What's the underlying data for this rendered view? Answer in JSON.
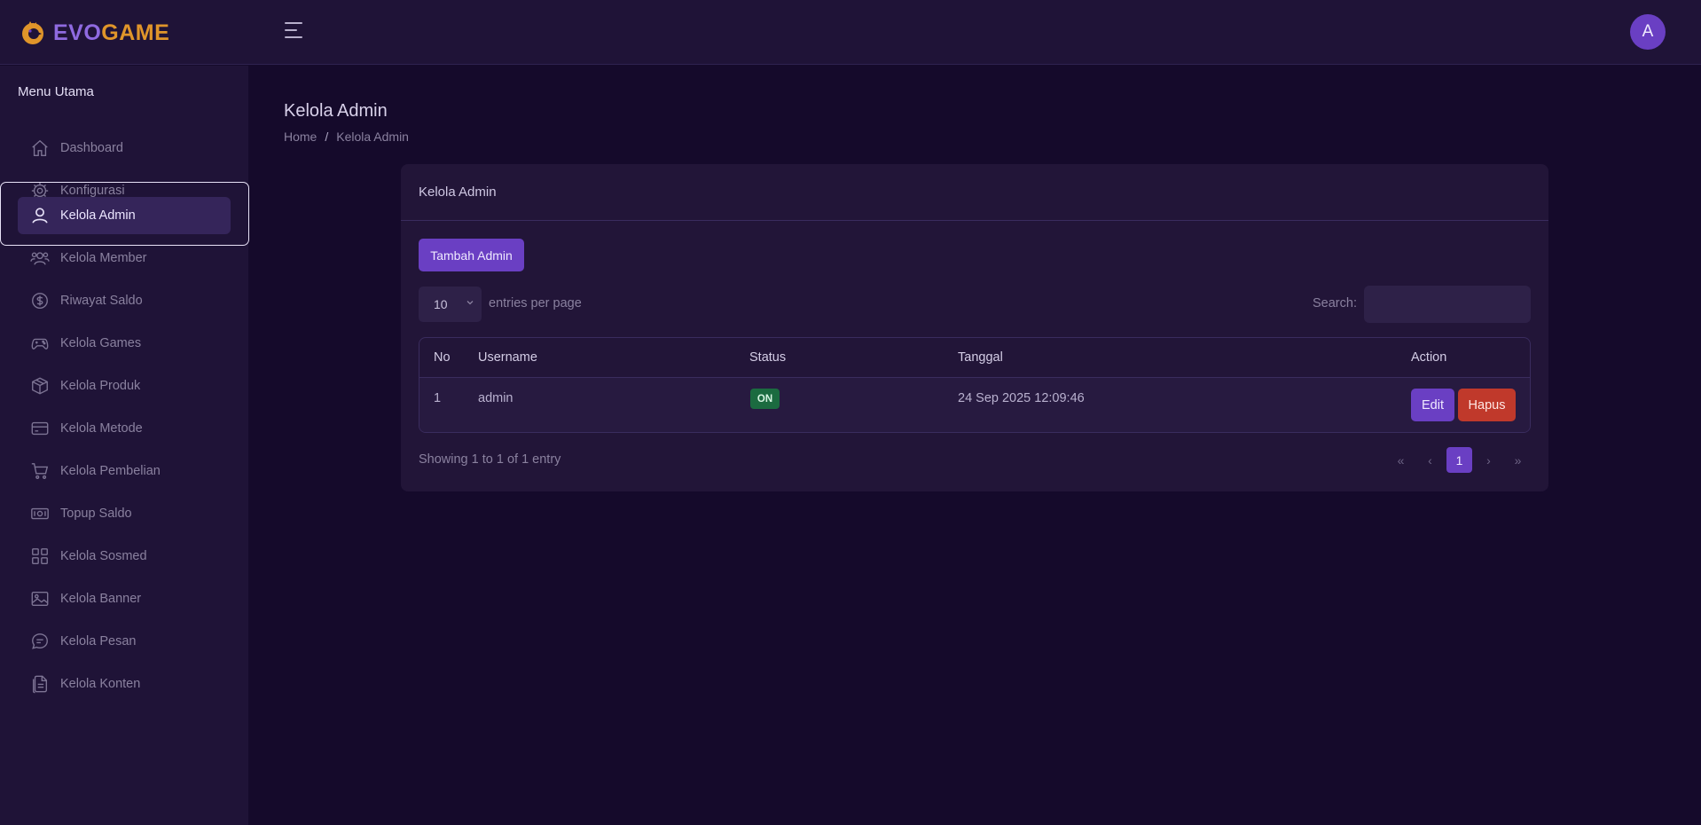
{
  "header": {
    "logo_part1": "EVO",
    "logo_part2": "GAME",
    "menu_toggle_icon": "hamburger-icon",
    "avatar_initial": "A"
  },
  "sidebar": {
    "title": "Menu Utama",
    "items": [
      {
        "label": "Dashboard",
        "icon": "home-icon"
      },
      {
        "label": "Konfigurasi",
        "icon": "gear-icon"
      },
      {
        "label": "Kelola Admin",
        "icon": "user-icon",
        "active": true
      },
      {
        "label": "Kelola Member",
        "icon": "users-icon"
      },
      {
        "label": "Riwayat Saldo",
        "icon": "dollar-icon"
      },
      {
        "label": "Kelola Games",
        "icon": "gamepad-icon"
      },
      {
        "label": "Kelola Produk",
        "icon": "box-icon"
      },
      {
        "label": "Kelola Metode",
        "icon": "card-icon"
      },
      {
        "label": "Kelola Pembelian",
        "icon": "cart-icon"
      },
      {
        "label": "Topup Saldo",
        "icon": "cash-icon"
      },
      {
        "label": "Kelola Sosmed",
        "icon": "grid-icon"
      },
      {
        "label": "Kelola Banner",
        "icon": "image-icon"
      },
      {
        "label": "Kelola Pesan",
        "icon": "chat-icon"
      },
      {
        "label": "Kelola Konten",
        "icon": "file-icon"
      }
    ]
  },
  "page": {
    "title": "Kelola Admin",
    "breadcrumb": [
      "Home",
      "Kelola Admin"
    ],
    "breadcrumb_sep": "/"
  },
  "card": {
    "title": "Kelola Admin",
    "add_button": "Tambah Admin",
    "entries_value": "10",
    "entries_label": "entries per page",
    "search_label": "Search:",
    "search_value": "",
    "columns": [
      "No",
      "Username",
      "Status",
      "Tanggal",
      "Action"
    ],
    "rows": [
      {
        "no": "1",
        "username": "admin",
        "status": "ON",
        "tanggal": "24 Sep 2025 12:09:46",
        "edit": "Edit",
        "delete": "Hapus"
      }
    ],
    "showing": "Showing 1 to 1 of 1 entry",
    "pagination": [
      "«",
      "‹",
      "1",
      "›",
      "»"
    ],
    "current_page": "1"
  },
  "colors": {
    "accent": "#6a3fc3",
    "danger": "#c0392b",
    "success": "#1b6b40",
    "logo_evo": "#8f6ae0",
    "logo_game": "#e0952a"
  }
}
